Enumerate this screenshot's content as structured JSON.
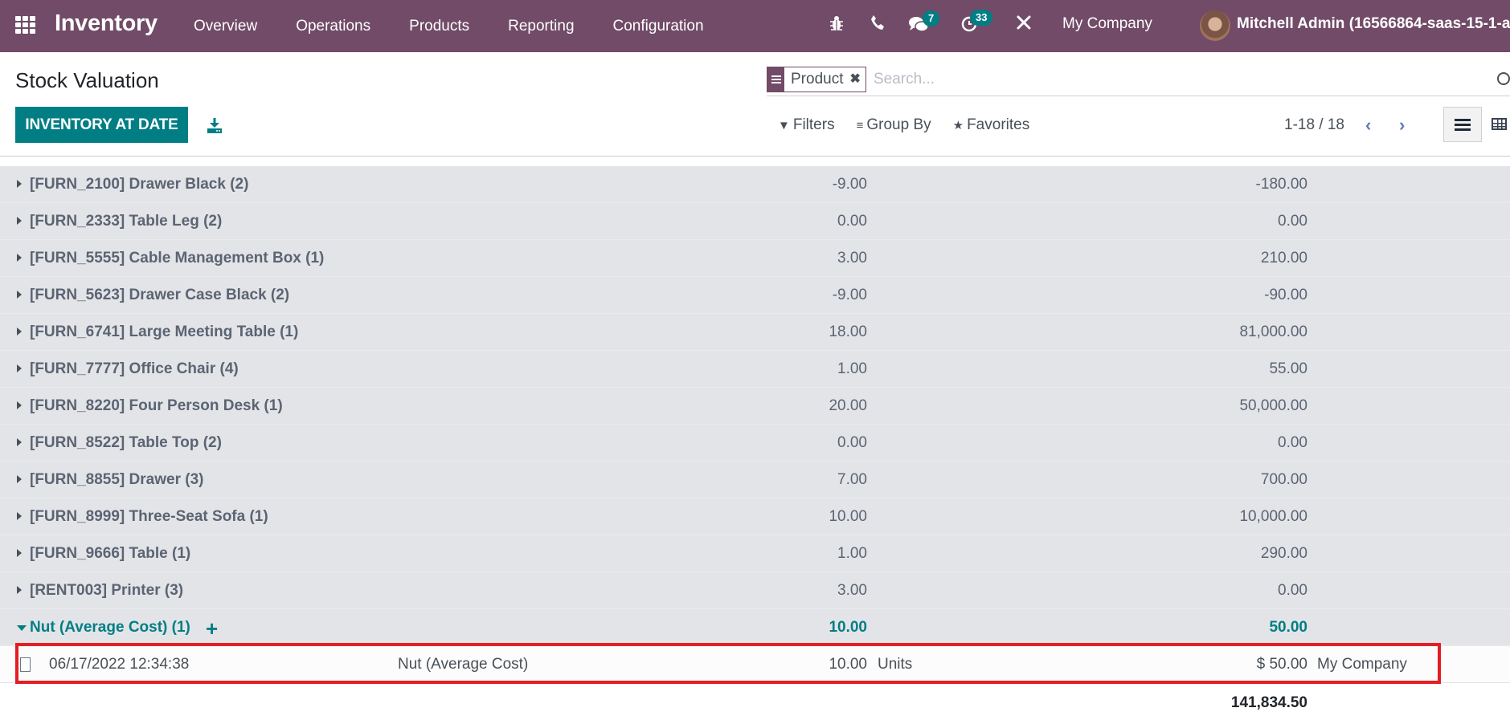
{
  "navbar": {
    "app_name": "Inventory",
    "menu": [
      "Overview",
      "Operations",
      "Products",
      "Reporting",
      "Configuration"
    ],
    "icons": {
      "debug": "bug-icon",
      "phone": "phone-icon",
      "messages": "chat-icon",
      "activities": "clock-icon",
      "settings": "tools-icon"
    },
    "messages_count": "7",
    "activities_count": "33",
    "company": "My Company",
    "user": "Mitchell Admin (16566864-saas-15-1-al"
  },
  "control_panel": {
    "title": "Stock Valuation",
    "primary_button": "INVENTORY AT DATE",
    "search": {
      "facet_label": "Product",
      "placeholder": "Search..."
    },
    "filters_label": "Filters",
    "group_by_label": "Group By",
    "favorites_label": "Favorites",
    "pager": "1-18 / 18"
  },
  "groups": [
    {
      "name": "[FURN_2100] Drawer Black (2)",
      "qty": "-9.00",
      "value": "-180.00"
    },
    {
      "name": "[FURN_2333] Table Leg (2)",
      "qty": "0.00",
      "value": "0.00"
    },
    {
      "name": "[FURN_5555] Cable Management Box (1)",
      "qty": "3.00",
      "value": "210.00"
    },
    {
      "name": "[FURN_5623] Drawer Case Black (2)",
      "qty": "-9.00",
      "value": "-90.00"
    },
    {
      "name": "[FURN_6741] Large Meeting Table (1)",
      "qty": "18.00",
      "value": "81,000.00"
    },
    {
      "name": "[FURN_7777] Office Chair (4)",
      "qty": "1.00",
      "value": "55.00"
    },
    {
      "name": "[FURN_8220] Four Person Desk (1)",
      "qty": "20.00",
      "value": "50,000.00"
    },
    {
      "name": "[FURN_8522] Table Top (2)",
      "qty": "0.00",
      "value": "0.00"
    },
    {
      "name": "[FURN_8855] Drawer (3)",
      "qty": "7.00",
      "value": "700.00"
    },
    {
      "name": "[FURN_8999] Three-Seat Sofa (1)",
      "qty": "10.00",
      "value": "10,000.00"
    },
    {
      "name": "[FURN_9666] Table (1)",
      "qty": "1.00",
      "value": "290.00"
    },
    {
      "name": "[RENT003] Printer (3)",
      "qty": "3.00",
      "value": "0.00"
    }
  ],
  "open_group": {
    "name": "Nut (Average Cost) (1)",
    "qty": "10.00",
    "value": "50.00",
    "record": {
      "date": "06/17/2022 12:34:38",
      "product": "Nut (Average Cost)",
      "quantity": "10.00",
      "uom": "Units",
      "value": "$ 50.00",
      "company": "My Company"
    }
  },
  "total_value": "141,834.50",
  "colors": {
    "brand": "#714b67",
    "accent": "#017e84",
    "highlight": "#e31e25"
  }
}
